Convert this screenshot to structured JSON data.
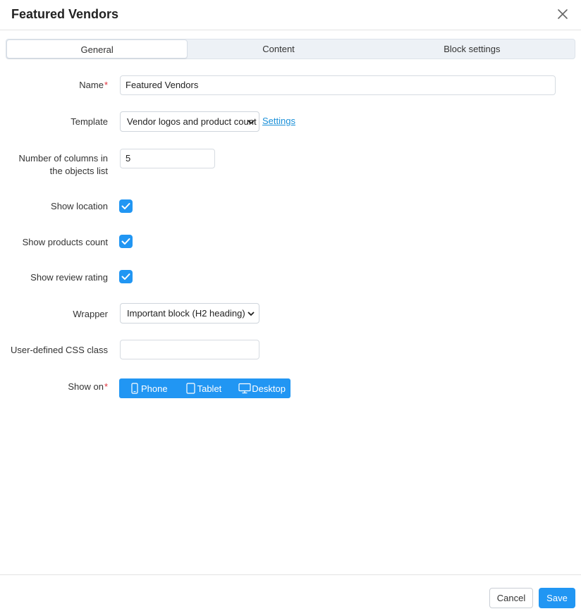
{
  "dialog": {
    "title": "Featured Vendors"
  },
  "tabs": [
    {
      "label": "General",
      "active": true
    },
    {
      "label": "Content",
      "active": false
    },
    {
      "label": "Block settings",
      "active": false
    }
  ],
  "form": {
    "name": {
      "label": "Name",
      "value": "Featured Vendors"
    },
    "template": {
      "label": "Template",
      "value": "Vendor logos and product count",
      "link": "Settings"
    },
    "columns": {
      "label_line1": "Number of columns in",
      "label_line2": "the objects list",
      "value": "5"
    },
    "show_location": {
      "label": "Show location",
      "checked": true
    },
    "show_products_count": {
      "label": "Show products count",
      "checked": true
    },
    "show_review_rating": {
      "label": "Show review rating",
      "checked": true
    },
    "wrapper": {
      "label": "Wrapper",
      "value": "Important block (H2 heading)"
    },
    "css_class": {
      "label": "User-defined CSS class",
      "value": ""
    },
    "show_on": {
      "label": "Show on",
      "options": [
        "Phone",
        "Tablet",
        "Desktop"
      ]
    }
  },
  "footer": {
    "cancel_label": "Cancel",
    "save_label": "Save"
  },
  "colors": {
    "accent": "#2196f3",
    "required": "#e0303b",
    "link": "#1b90d8"
  },
  "icons": {
    "close": "close-icon",
    "checkbox": "checkmark-icon",
    "phone": "phone-icon",
    "tablet": "tablet-icon",
    "desktop": "desktop-icon",
    "select_arrow": "chevron-down-icon"
  }
}
